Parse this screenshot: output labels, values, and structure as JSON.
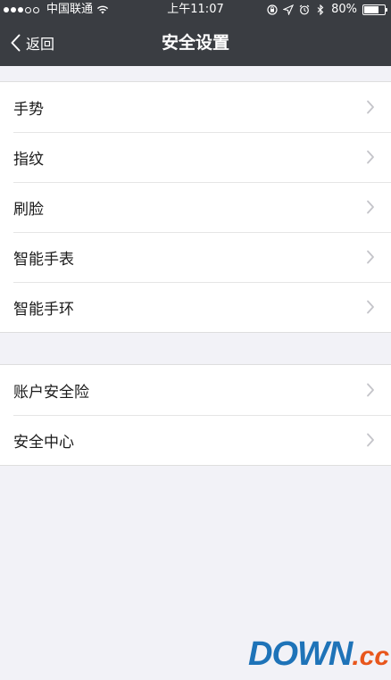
{
  "status_bar": {
    "carrier": "中国联通",
    "time": "上午11:07",
    "battery": "80%",
    "battery_level": 0.8
  },
  "nav": {
    "back_label": "返回",
    "title": "安全设置"
  },
  "groups": [
    {
      "items": [
        {
          "label": "手势",
          "icon": "chevron-right-icon"
        },
        {
          "label": "指纹",
          "icon": "chevron-right-icon"
        },
        {
          "label": "刷脸",
          "icon": "chevron-right-icon"
        },
        {
          "label": "智能手表",
          "icon": "chevron-right-icon"
        },
        {
          "label": "智能手环",
          "icon": "chevron-right-icon"
        }
      ]
    },
    {
      "items": [
        {
          "label": "账户安全险",
          "icon": "chevron-right-icon"
        },
        {
          "label": "安全中心",
          "icon": "chevron-right-icon"
        }
      ]
    }
  ],
  "watermark": {
    "text_main": "DOWN",
    "text_suffix": ".cc",
    "colors": {
      "main": "#1e73b8",
      "suffix": "#e8561c"
    }
  },
  "colors": {
    "header_bg": "#3a3d42",
    "page_bg": "#f2f2f7",
    "row_bg": "#ffffff",
    "chevron": "#c4c4c9"
  }
}
